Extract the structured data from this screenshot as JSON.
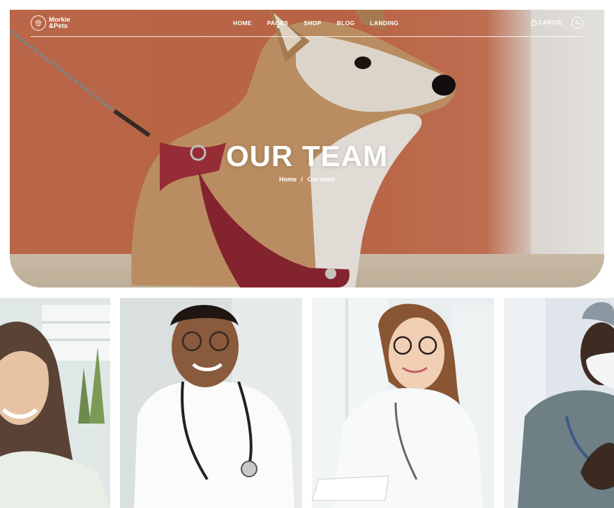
{
  "brand": {
    "name_line1": "Morkie",
    "name_line2": "&Pets"
  },
  "nav": {
    "items": [
      {
        "label": "HOME"
      },
      {
        "label": "PAGES"
      },
      {
        "label": "SHOP"
      },
      {
        "label": "BLOG"
      },
      {
        "label": "LANDING"
      }
    ],
    "cart_label": "CART(0)"
  },
  "hero": {
    "title": "OUR TEAM",
    "breadcrumb": {
      "home": "Home",
      "separator": "/",
      "current": "Our team"
    }
  },
  "team": [
    {
      "photo": "woman-smiling-plant"
    },
    {
      "photo": "doctor-stethoscope-white-tshirt"
    },
    {
      "photo": "doctor-glasses-white-coat"
    },
    {
      "photo": "doctor-mask-scrubs"
    }
  ],
  "colors": {
    "hero_wall": "#c9704f",
    "text": "#ffffff"
  }
}
